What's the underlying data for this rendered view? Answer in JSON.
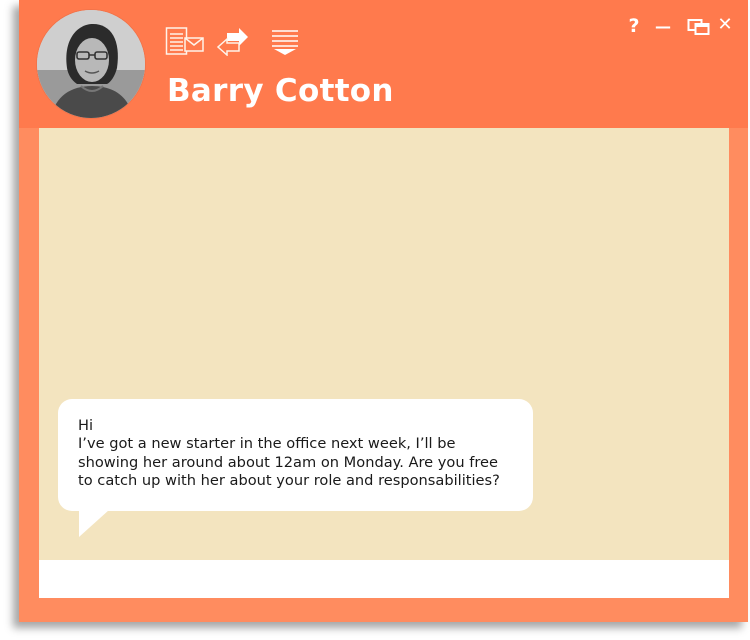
{
  "contact": {
    "name": "Barry Cotton",
    "avatar_icon": "user-avatar-photo"
  },
  "toolbar": {
    "icons": [
      "mail-icon",
      "swap-arrows-icon",
      "collapse-menu-icon"
    ]
  },
  "window_controls": {
    "help": "?",
    "minimize": "—",
    "restore_icon": "restore-windows-icon",
    "close": "✕"
  },
  "messages": [
    {
      "from": "contact",
      "lines": [
        "Hi",
        "I’ve got a new starter in the office next week, I’ll be",
        "showing her around about 12am on Monday. Are you free",
        "to catch up with her about your role and responsabilities?"
      ]
    }
  ],
  "input": {
    "value": "",
    "placeholder": ""
  },
  "colors": {
    "header": "#ff7a4d",
    "frame": "#ff8c5f",
    "chat_background": "#f3e4bf",
    "bubble": "#ffffff",
    "text": "#1a1a1a"
  }
}
